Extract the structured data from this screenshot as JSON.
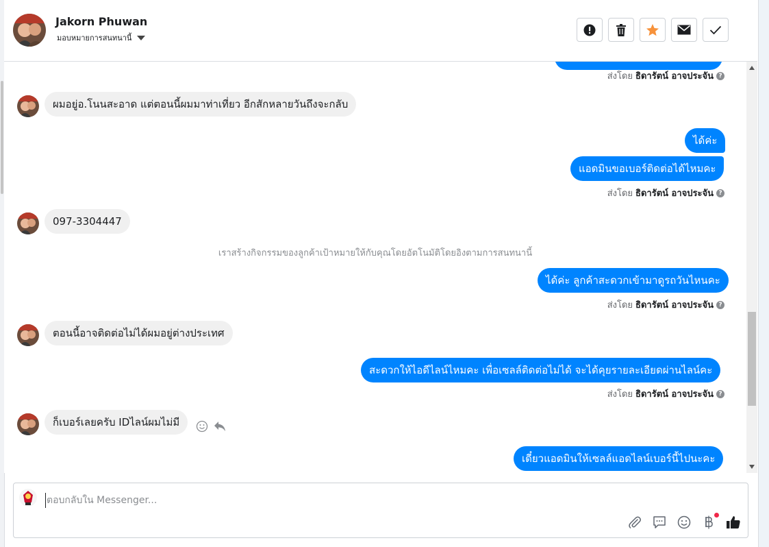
{
  "header": {
    "name": "Jakorn Phuwan",
    "assign_label": "มอบหมายการสนทนานี้"
  },
  "toolbar": {
    "buttons": [
      {
        "icon": "alert-icon"
      },
      {
        "icon": "trash-icon"
      },
      {
        "icon": "star-icon",
        "color": "#f7923b"
      },
      {
        "icon": "mail-icon"
      },
      {
        "icon": "check-icon"
      }
    ]
  },
  "messages": {
    "sent_by_prefix": "ส่งโดย",
    "agent_name": "ธิดารัตน์ อาจประจัน",
    "m1": "ผมอยู่อ.โนนสะอาด แต่ตอนนี้ผมมาท่าเที่ยว อีกสักหลายวันถึงจะกลับ",
    "m2": "ได้ค่ะ",
    "m3": "แอดมินขอเบอร์ติดต่อได้ไหมคะ",
    "m4": "097-3304447",
    "system_note": "เราสร้างกิจกรรมของลูกค้าเป้าหมายให้กับคุณโดยอัตโนมัติโดยอิงตามการสนทนานี้",
    "m5": "ได้ค่ะ ลูกค้าสะดวกเข้ามาดูรถวันไหนคะ",
    "m6": "ตอนนี้อาจติดต่อไม่ได้ผมอยู่ต่างประเทศ",
    "m7": "สะดวกให้ไอดีไลน์ไหมคะ เพื่อเซลล์ติดต่อไม่ได้ จะได้คุยรายละเอียดผ่านไลน์คะ",
    "m8": "ก็เบอร์เลยครับ IDไลน์ผมไม่มี",
    "m9": "เดี๋ยวแอดมินให้เซลล์แอดไลน์เบอร์นี้ไปนะคะ"
  },
  "composer": {
    "placeholder": "ตอบกลับใน Messenger..."
  },
  "colors": {
    "outgoing_bubble": "#0084ff",
    "incoming_bubble": "#f0f0f0",
    "notification_dot": "#f02849"
  }
}
